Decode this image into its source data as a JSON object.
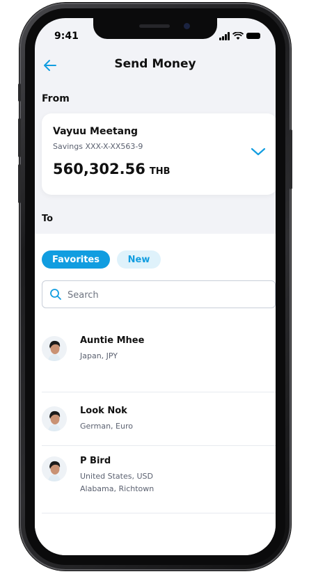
{
  "status": {
    "time": "9:41"
  },
  "header": {
    "title": "Send Money"
  },
  "from": {
    "label": "From",
    "account_name": "Vayuu Meetang",
    "account_number": "Savings XXX-X-XX563-9",
    "balance": "560,302.56",
    "currency": "THB"
  },
  "to": {
    "label": "To"
  },
  "tabs": [
    {
      "label": "Favorites",
      "active": true
    },
    {
      "label": "New",
      "active": false
    }
  ],
  "search": {
    "placeholder": "Search"
  },
  "contacts": [
    {
      "name": "Auntie Mhee",
      "line1": "Japan, JPY"
    },
    {
      "name": "Look Nok",
      "line1": "German, Euro"
    },
    {
      "name": "P Bird",
      "line1": "United States, USD",
      "line2": "Alabama, Richtown"
    }
  ],
  "colors": {
    "accent": "#119de0",
    "accent_light": "#dff2fb",
    "screen_bg": "#f2f3f7"
  }
}
